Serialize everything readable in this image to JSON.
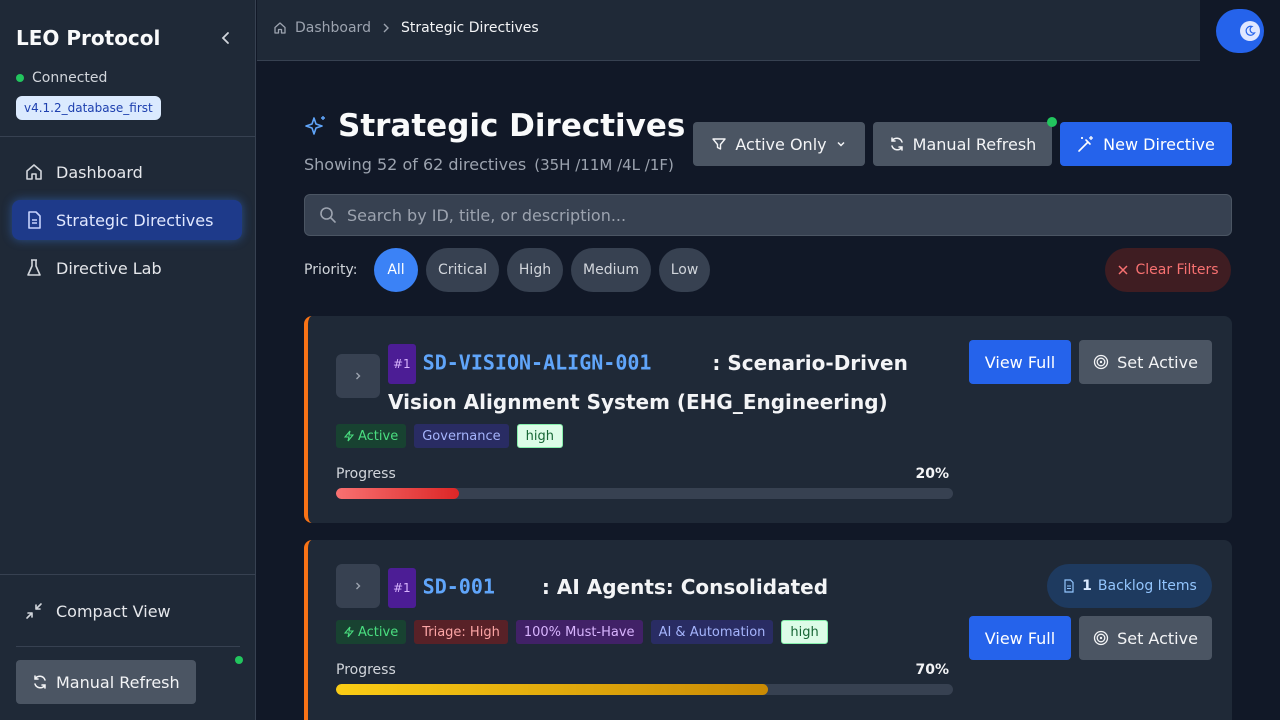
{
  "sidebar": {
    "brand": "LEO Protocol",
    "connection": "Connected",
    "version": "v4.1.2_database_first",
    "nav": [
      {
        "label": "Dashboard",
        "icon": "home-icon"
      },
      {
        "label": "Strategic Directives",
        "icon": "document-icon",
        "active": true
      },
      {
        "label": "Directive Lab",
        "icon": "flask-icon"
      }
    ],
    "compact_view": "Compact View",
    "manual_refresh": "Manual Refresh"
  },
  "breadcrumb": {
    "home": "Dashboard",
    "current": "Strategic Directives"
  },
  "header": {
    "title": "Strategic Directives",
    "summary": "Showing 52 of 62 directives",
    "counts": "(35H /11M /4L /1F)",
    "filter_label": "Active Only",
    "refresh_label": "Manual Refresh",
    "new_label": "New Directive"
  },
  "search": {
    "placeholder": "Search by ID, title, or description..."
  },
  "priority_filter": {
    "label": "Priority:",
    "options": [
      "All",
      "Critical",
      "High",
      "Medium",
      "Low"
    ],
    "selected": "All",
    "clear_label": "Clear Filters"
  },
  "directives": [
    {
      "rank": "#1",
      "id": "SD-VISION-ALIGN-001",
      "title_line1": ": Scenario-Driven",
      "title_line2": "Vision Alignment System (EHG_Engineering)",
      "tags": [
        "Active",
        "Governance",
        "high"
      ],
      "progress_label": "Progress",
      "progress": 20,
      "progress_text": "20%",
      "view_label": "View Full",
      "set_active_label": "Set Active"
    },
    {
      "rank": "#1",
      "id": "SD-001",
      "title_line1": ": AI Agents: Consolidated",
      "tags": [
        "Active",
        "Triage: High",
        "100% Must-Have",
        "AI & Automation",
        "high"
      ],
      "backlog_count": "1",
      "backlog_label": "Backlog Items",
      "progress_label": "Progress",
      "progress": 70,
      "progress_text": "70%",
      "view_label": "View Full",
      "set_active_label": "Set Active"
    }
  ],
  "colors": {
    "accent": "#2563eb",
    "priority_border": "#f97316",
    "progress_low": "#ef4444",
    "progress_mid": "#eab308"
  }
}
